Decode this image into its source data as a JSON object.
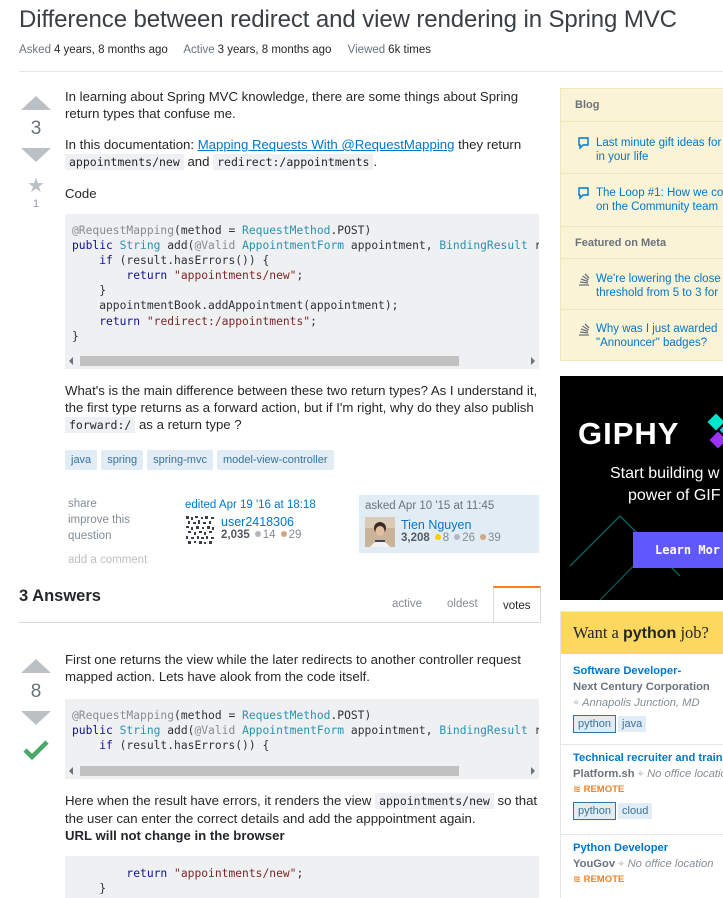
{
  "question": {
    "title": "Difference between redirect and view rendering in Spring MVC",
    "meta": {
      "asked_label": "Asked",
      "asked_value": "4 years, 8 months ago",
      "active_label": "Active",
      "active_value": "3 years, 8 months ago",
      "viewed_label": "Viewed",
      "viewed_value": "6k times"
    },
    "votes": "3",
    "favorites": "1",
    "body": {
      "p1": "In learning about Spring MVC knowledge, there are some things about Spring return types that confuse me.",
      "p2_prefix": "In this documentation: ",
      "p2_link": "Mapping Requests With @RequestMapping",
      "p2_mid": " they return ",
      "p2_code1": "appointments/new",
      "p2_and": " and ",
      "p2_code2": "redirect:/appointments",
      "p2_end": ".",
      "p3": "Code",
      "p4_prefix": "What's is the main difference between these two return types? As I understand it, the first type returns as a forward action, but if I'm right, why do they also publish ",
      "p4_code": "forward:/",
      "p4_suffix": " as a return type ?"
    },
    "tags": [
      "java",
      "spring",
      "spring-mvc",
      "model-view-controller"
    ],
    "menu": {
      "share": "share",
      "improve": "improve this question",
      "add_comment": "add a comment"
    },
    "edited": {
      "action": "edited Apr 19 '16 at 18:18",
      "user": "user2418306",
      "rep": "2,035",
      "silver": "14",
      "bronze": "29"
    },
    "asked": {
      "action": "asked Apr 10 '15 at 11:45",
      "user": "Tien Nguyen",
      "rep": "3,208",
      "gold": "8",
      "silver": "26",
      "bronze": "39"
    }
  },
  "answers": {
    "header": "3 Answers",
    "sort_tabs": [
      "active",
      "oldest",
      "votes"
    ],
    "first": {
      "votes": "8",
      "p1": "First one returns the view while the later redirects to another controller request mapped action. Lets have alook from the code itself.",
      "p2_prefix": "Here when the result have errors, it renders the view ",
      "p2_code": "appointments/new",
      "p2_suffix": " so that the user can enter the correct details and add the apppointment again.",
      "p2_bold": "URL will not change in the browser"
    }
  },
  "sidebar": {
    "blog_label": "Blog",
    "blog_items": [
      {
        "line1": "Last minute gift ideas for",
        "line2": "in your life"
      },
      {
        "line1": "The Loop #1: How we co",
        "line2": "on the Community team"
      }
    ],
    "meta_label": "Featured on Meta",
    "meta_items": [
      {
        "line1": "We're lowering the close",
        "line2": "threshold from 5 to 3 for"
      },
      {
        "line1": "Why was I just awarded",
        "line2": "\"Announcer\" badges?"
      }
    ],
    "ad": {
      "brand": "GIPHY",
      "line1": "Start building w",
      "line2": "power of GIF",
      "button": "Learn Mor"
    },
    "jobs": {
      "head_prefix": "Want a ",
      "head_lang": "python",
      "head_suffix": " job?",
      "items": [
        {
          "title": "Software Developer-",
          "company": "Next Century Corporation",
          "location": "Annapolis Junction, MD",
          "remote": "",
          "tags": [
            "python",
            "java"
          ]
        },
        {
          "title": "Technical recruiter and train",
          "company": "Platform.sh",
          "location": "No office location",
          "remote": "REMOTE",
          "tags": [
            "python",
            "cloud"
          ]
        },
        {
          "title": "Python Developer",
          "company": "YouGov",
          "location": "No office location",
          "remote": "REMOTE",
          "tags": []
        }
      ]
    }
  },
  "colors": {
    "link": "#0077cc",
    "accepted": "#48a868",
    "orange": "#f48024",
    "gold": "#ffcc01",
    "silver": "#b4b8bc",
    "bronze": "#d1a684"
  }
}
